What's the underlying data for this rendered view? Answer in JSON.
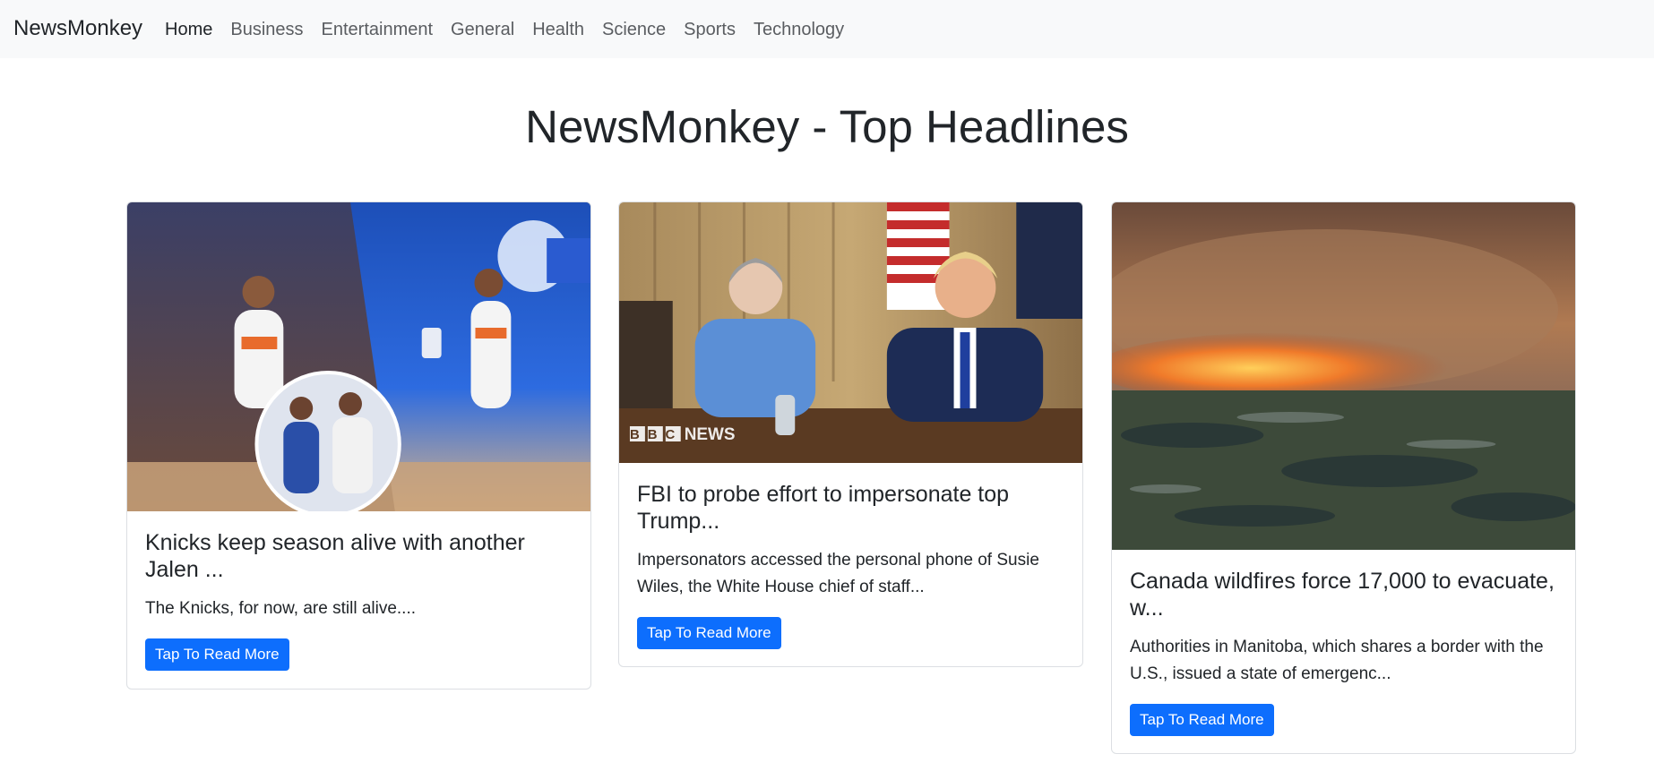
{
  "navbar": {
    "brand": "NewsMonkey",
    "links": [
      {
        "label": "Home",
        "active": true
      },
      {
        "label": "Business",
        "active": false
      },
      {
        "label": "Entertainment",
        "active": false
      },
      {
        "label": "General",
        "active": false
      },
      {
        "label": "Health",
        "active": false
      },
      {
        "label": "Science",
        "active": false
      },
      {
        "label": "Sports",
        "active": false
      },
      {
        "label": "Technology",
        "active": false
      }
    ]
  },
  "heading": "NewsMonkey - Top Headlines",
  "articles": [
    {
      "image": "basketball-players-photo",
      "title": "Knicks keep season alive with another Jalen ...",
      "description": "The Knicks, for now, are still alive....",
      "button_label": "Tap To Read More"
    },
    {
      "image": "press-meeting-photo",
      "image_watermark": "BBC NEWS",
      "title": "FBI to probe effort to impersonate top Trump...",
      "description": "Impersonators accessed the personal phone of Susie Wiles, the White House chief of staff...",
      "button_label": "Tap To Read More"
    },
    {
      "image": "wildfire-aerial-photo",
      "title": "Canada wildfires force 17,000 to evacuate, w...",
      "description": "Authorities in Manitoba, which shares a border with the U.S., issued a state of emergenc...",
      "button_label": "Tap To Read More"
    }
  ],
  "colors": {
    "navbar_bg": "#f8f9fa",
    "button_bg": "#0d6efd",
    "text": "#212529"
  }
}
